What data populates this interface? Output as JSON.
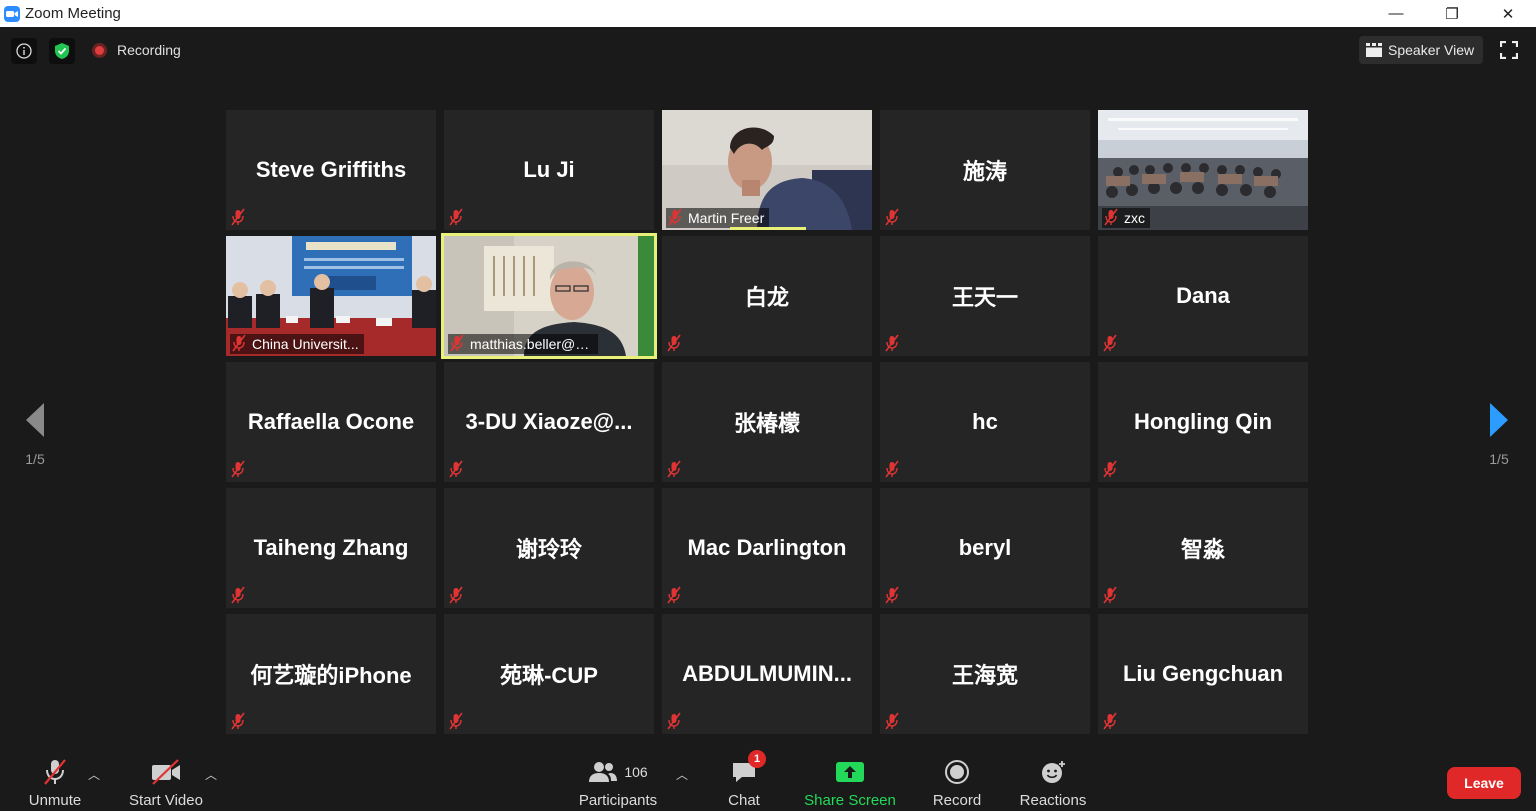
{
  "window": {
    "title": "Zoom Meeting",
    "minimize": "—",
    "restore": "❐",
    "close": "✕"
  },
  "topbar": {
    "recording_label": "Recording",
    "speaker_view_label": "Speaker View"
  },
  "pager": {
    "left_label": "1/5",
    "right_label": "1/5"
  },
  "participants": [
    {
      "name": "Steve Griffiths",
      "video": false
    },
    {
      "name": "Lu Ji",
      "video": false
    },
    {
      "name": "Martin Freer",
      "video": true,
      "scene": "man-profile",
      "speaking": true
    },
    {
      "name": "施涛",
      "video": false
    },
    {
      "name": "zxc",
      "video": true,
      "scene": "lecture-hall"
    },
    {
      "name": "China Universit...",
      "video": true,
      "scene": "meeting-room"
    },
    {
      "name": "matthias.beller@u...",
      "video": true,
      "scene": "older-man",
      "active": true
    },
    {
      "name": "白龙",
      "video": false
    },
    {
      "name": "王天一",
      "video": false
    },
    {
      "name": "Dana",
      "video": false
    },
    {
      "name": "Raffaella Ocone",
      "video": false
    },
    {
      "name": "3-DU  Xiaoze@...",
      "video": false
    },
    {
      "name": "张椿檬",
      "video": false
    },
    {
      "name": "hc",
      "video": false
    },
    {
      "name": "Hongling Qin",
      "video": false
    },
    {
      "name": "Taiheng Zhang",
      "video": false
    },
    {
      "name": "谢玲玲",
      "video": false
    },
    {
      "name": "Mac Darlington",
      "video": false
    },
    {
      "name": "beryl",
      "video": false
    },
    {
      "name": "智淼",
      "video": false
    },
    {
      "name": "何艺璇的iPhone",
      "video": false
    },
    {
      "name": "苑琳-CUP",
      "video": false
    },
    {
      "name": "ABDULMUMIN...",
      "video": false
    },
    {
      "name": "王海宽",
      "video": false
    },
    {
      "name": "Liu Gengchuan",
      "video": false
    }
  ],
  "toolbar": {
    "unmute_label": "Unmute",
    "start_video_label": "Start Video",
    "participants_label": "Participants",
    "participants_count": "106",
    "chat_label": "Chat",
    "chat_badge": "1",
    "share_screen_label": "Share Screen",
    "record_label": "Record",
    "reactions_label": "Reactions",
    "leave_label": "Leave"
  },
  "colors": {
    "share_green": "#23d959",
    "leave_red": "#e02828",
    "active_border": "#e8f079",
    "mute_red": "#e03434",
    "zoom_blue": "#2d8cff"
  },
  "icons": [
    "info-icon",
    "shield-icon",
    "recording-dot-icon",
    "speaker-view-icon",
    "fullscreen-icon",
    "chevron-left-icon",
    "chevron-right-icon",
    "mic-muted-icon",
    "video-off-icon",
    "participants-icon",
    "chat-icon",
    "share-screen-icon",
    "record-icon",
    "reactions-icon"
  ]
}
